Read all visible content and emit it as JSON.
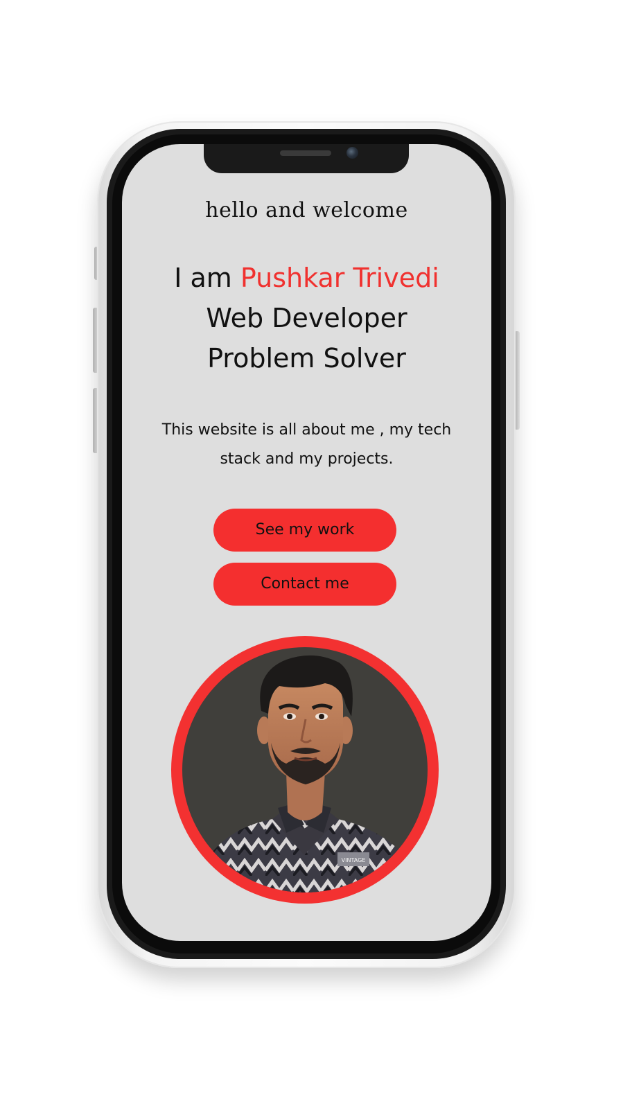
{
  "screen": {
    "greeting": "hello and welcome",
    "headline": {
      "prefix": "I am",
      "name": "Pushkar Trivedi",
      "line2": "Web Developer",
      "line3": "Problem Solver"
    },
    "tagline": "This website is all about me , my tech stack and my projects.",
    "buttons": {
      "work": "See my work",
      "contact": "Contact me"
    },
    "avatar": {
      "icon": "profile-photo",
      "shirt_text": "VINTAGE"
    }
  },
  "colors": {
    "accent": "#f42f2f",
    "screen_bg": "#dedede",
    "text": "#111111",
    "avatar_bg": "#403f3b"
  }
}
